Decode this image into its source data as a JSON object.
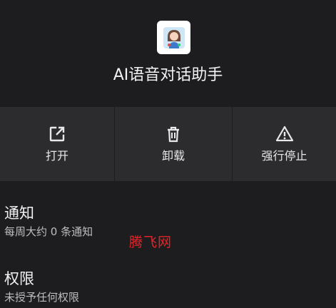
{
  "app": {
    "name": "AI语音对话助手",
    "icon": "assistant-avatar-icon"
  },
  "actions": [
    {
      "label": "打开",
      "icon": "open-external-icon"
    },
    {
      "label": "卸载",
      "icon": "trash-icon"
    },
    {
      "label": "强行停止",
      "icon": "warning-icon"
    }
  ],
  "notifications": {
    "title": "通知",
    "summary": "每周大约 0 条通知"
  },
  "permissions": {
    "title": "权限",
    "summary": "未授予任何权限"
  },
  "watermark": "腾飞网",
  "colors": {
    "background": "#1d1d1f",
    "button_bg": "#2c2c2e",
    "watermark": "#e0262a"
  }
}
